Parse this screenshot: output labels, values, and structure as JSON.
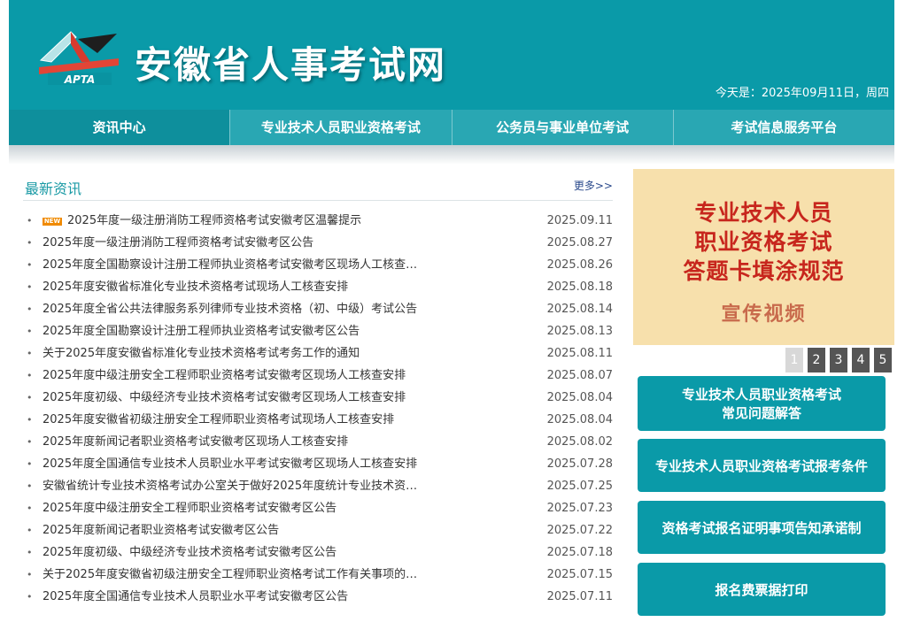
{
  "header": {
    "site_title": "安徽省人事考试网",
    "logo_text": "APTA",
    "today": "今天是：2025年09月11日，周四"
  },
  "nav": [
    {
      "label": "资讯中心"
    },
    {
      "label": "专业技术人员职业资格考试"
    },
    {
      "label": "公务员与事业单位考试"
    },
    {
      "label": "考试信息服务平台"
    }
  ],
  "news": {
    "title": "最新资讯",
    "more": "更多>>",
    "new_badge": "NEW",
    "items": [
      {
        "title": "2025年度一级注册消防工程师资格考试安徽考区温馨提示",
        "date": "2025.09.11",
        "is_new": true
      },
      {
        "title": "2025年度一级注册消防工程师资格考试安徽考区公告",
        "date": "2025.08.27"
      },
      {
        "title": "2025年度全国勘察设计注册工程师执业资格考试安徽考区现场人工核查…",
        "date": "2025.08.26"
      },
      {
        "title": "2025年度安徽省标准化专业技术资格考试现场人工核查安排",
        "date": "2025.08.18"
      },
      {
        "title": "2025年度全省公共法律服务系列律师专业技术资格（初、中级）考试公告",
        "date": "2025.08.14"
      },
      {
        "title": "2025年度全国勘察设计注册工程师执业资格考试安徽考区公告",
        "date": "2025.08.13"
      },
      {
        "title": "关于2025年度安徽省标准化专业技术资格考试考务工作的通知",
        "date": "2025.08.11"
      },
      {
        "title": "2025年度中级注册安全工程师职业资格考试安徽考区现场人工核查安排",
        "date": "2025.08.07"
      },
      {
        "title": "2025年度初级、中级经济专业技术资格考试安徽考区现场人工核查安排",
        "date": "2025.08.04"
      },
      {
        "title": "2025年度安徽省初级注册安全工程师职业资格考试现场人工核查安排",
        "date": "2025.08.04"
      },
      {
        "title": "2025年度新闻记者职业资格考试安徽考区现场人工核查安排",
        "date": "2025.08.02"
      },
      {
        "title": "2025年度全国通信专业技术人员职业水平考试安徽考区现场人工核查安排",
        "date": "2025.07.28"
      },
      {
        "title": "安徽省统计专业技术资格考试办公室关于做好2025年度统计专业技术资…",
        "date": "2025.07.25"
      },
      {
        "title": "2025年度中级注册安全工程师职业资格考试安徽考区公告",
        "date": "2025.07.23"
      },
      {
        "title": "2025年度新闻记者职业资格考试安徽考区公告",
        "date": "2025.07.22"
      },
      {
        "title": "2025年度初级、中级经济专业技术资格考试安徽考区公告",
        "date": "2025.07.18"
      },
      {
        "title": "关于2025年度安徽省初级注册安全工程师职业资格考试工作有关事项的…",
        "date": "2025.07.15"
      },
      {
        "title": "2025年度全国通信专业技术人员职业水平考试安徽考区公告",
        "date": "2025.07.11"
      }
    ]
  },
  "banner": {
    "line1": "专业技术人员",
    "line2": "职业资格考试",
    "line3": "答题卡填涂规范",
    "sub": "宣传视频"
  },
  "pager": [
    "1",
    "2",
    "3",
    "4",
    "5"
  ],
  "side_buttons": [
    {
      "line1": "专业技术人员职业资格考试",
      "line2": "常见问题解答"
    },
    {
      "line1": "专业技术人员职业资格考试报考条件"
    },
    {
      "line1": "资格考试报名证明事项告知承诺制"
    },
    {
      "line1": "报名费票据打印"
    }
  ],
  "colors": {
    "brand": "#0a9aa8",
    "nav": "#29a7b3",
    "nav_active": "#0e8f9c",
    "banner_bg": "#f7e0ac",
    "banner_text": "#c7261d"
  }
}
